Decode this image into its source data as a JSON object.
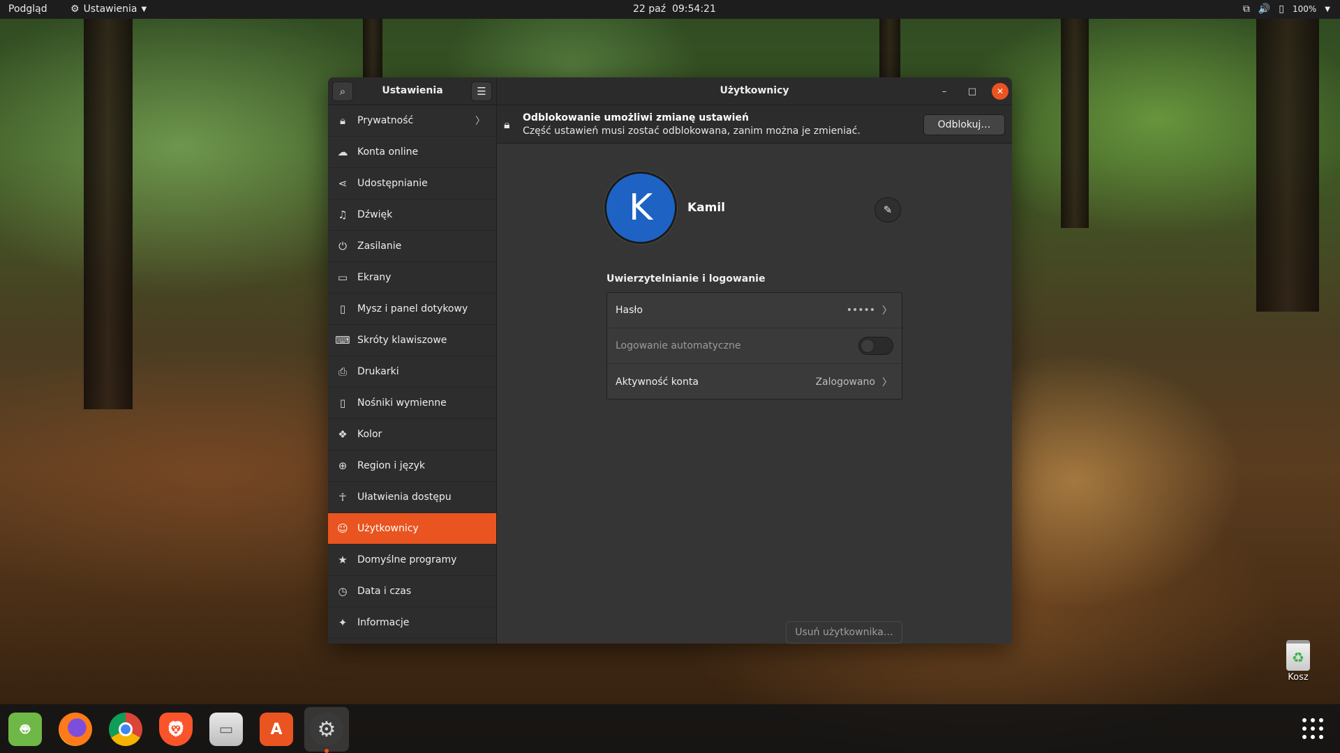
{
  "topbar": {
    "activities": "Podgląd",
    "app_menu_label": "Ustawienia",
    "clock": "22 paź  09:54:21",
    "battery": "100%"
  },
  "window": {
    "sidebar_title": "Ustawienia",
    "page_title": "Użytkownicy"
  },
  "sidebar": {
    "items": [
      {
        "label": "Prywatność",
        "icon": "lock-icon"
      },
      {
        "label": "Konta online",
        "icon": "cloud-icon"
      },
      {
        "label": "Udostępnianie",
        "icon": "share-icon"
      },
      {
        "label": "Dźwięk",
        "icon": "music-note-icon"
      },
      {
        "label": "Zasilanie",
        "icon": "power-icon"
      },
      {
        "label": "Ekrany",
        "icon": "display-icon"
      },
      {
        "label": "Mysz i panel dotykowy",
        "icon": "mouse-icon"
      },
      {
        "label": "Skróty klawiszowe",
        "icon": "keyboard-icon"
      },
      {
        "label": "Drukarki",
        "icon": "printer-icon"
      },
      {
        "label": "Nośniki wymienne",
        "icon": "usb-drive-icon"
      },
      {
        "label": "Kolor",
        "icon": "color-icon"
      },
      {
        "label": "Region i język",
        "icon": "globe-icon"
      },
      {
        "label": "Ułatwienia dostępu",
        "icon": "accessibility-icon"
      },
      {
        "label": "Użytkownicy",
        "icon": "users-icon"
      },
      {
        "label": "Domyślne programy",
        "icon": "star-icon"
      },
      {
        "label": "Data i czas",
        "icon": "clock-icon"
      },
      {
        "label": "Informacje",
        "icon": "info-star-icon"
      }
    ],
    "active_index": 13
  },
  "infobar": {
    "title": "Odblokowanie umożliwi zmianę ustawień",
    "subtitle": "Część ustawień musi zostać odblokowana, zanim można je zmieniać.",
    "unlock_label": "Odblokuj…"
  },
  "user": {
    "initial": "K",
    "name": "Kamil"
  },
  "auth": {
    "section_title": "Uwierzytelnianie i logowanie",
    "password_label": "Hasło",
    "password_value": "•••••",
    "autologin_label": "Logowanie automatyczne",
    "autologin_enabled": false,
    "activity_label": "Aktywność konta",
    "activity_value": "Zalogowano"
  },
  "delete_user_label": "Usuń użytkownika…",
  "desktop": {
    "trash_label": "Kosz"
  },
  "dock": {
    "apps": [
      "android-studio-icon",
      "firefox-icon",
      "chrome-icon",
      "brave-icon",
      "files-icon",
      "software-center-icon",
      "settings-icon"
    ],
    "running": "settings-icon"
  },
  "colors": {
    "accent": "#e95420",
    "avatar": "#1e63c4"
  }
}
